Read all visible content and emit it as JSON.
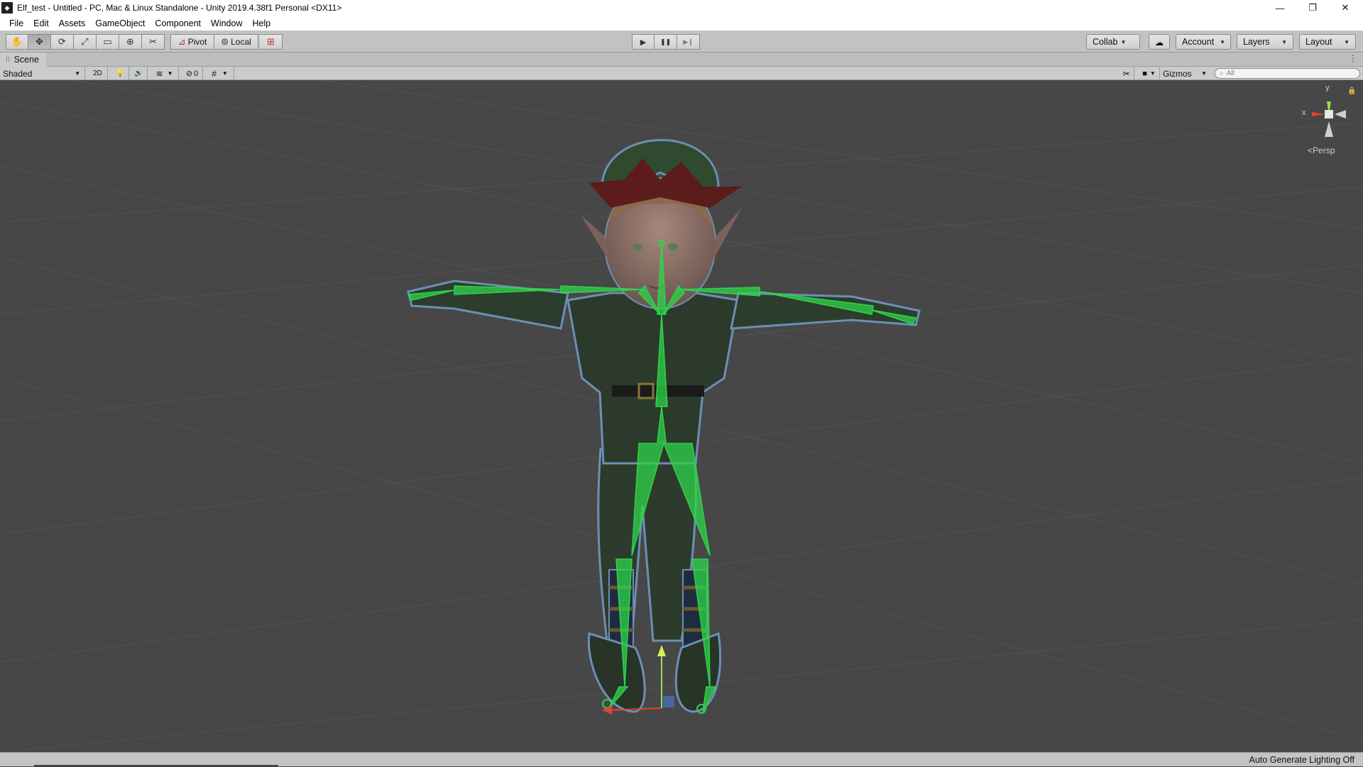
{
  "window": {
    "title": "Elf_test - Untitled - PC, Mac & Linux Standalone - Unity 2019.4.38f1 Personal <DX11>",
    "minimize": "—",
    "maximize": "❐",
    "close": "✕"
  },
  "menu": [
    "File",
    "Edit",
    "Assets",
    "GameObject",
    "Component",
    "Window",
    "Help"
  ],
  "toolbar": {
    "tools": [
      {
        "name": "hand-tool",
        "icon": "hand-icon",
        "glyph": "✋"
      },
      {
        "name": "move-tool",
        "icon": "move-icon",
        "glyph": "✥"
      },
      {
        "name": "rotate-tool",
        "icon": "rotate-icon",
        "glyph": "⟳"
      },
      {
        "name": "scale-tool",
        "icon": "scale-icon",
        "glyph": "⤢"
      },
      {
        "name": "rect-tool",
        "icon": "rect-icon",
        "glyph": "▭"
      },
      {
        "name": "transform-tool",
        "icon": "transform-icon",
        "glyph": "⊕"
      },
      {
        "name": "custom-tool",
        "icon": "custom-tools-icon",
        "glyph": "✂"
      }
    ],
    "pivot_label": "Pivot",
    "local_label": "Local",
    "play_icon": "▶",
    "pause_icon": "❚❚",
    "step_icon": "▶❙",
    "collab_label": "Collab",
    "cloud_icon": "☁",
    "account_label": "Account",
    "layers_label": "Layers",
    "layout_label": "Layout"
  },
  "scene_tab": {
    "label": "Scene",
    "menu_icon": "⋮"
  },
  "scene_controls": {
    "shading_mode": "Shaded",
    "mode_2d": "2D",
    "light_icon": "💡",
    "audio_icon": "🔊",
    "effects_icon": "≋",
    "hidden_count": "0",
    "gizmos_label": "Gizmos",
    "search_placeholder": "All"
  },
  "viewport": {
    "gizmo_axis_y": "y",
    "gizmo_axis_x": "x",
    "projection_label": "Persp",
    "lock_icon": "🔒"
  },
  "status": {
    "text": "Auto Generate Lighting Off"
  },
  "colors": {
    "background": "#474747",
    "bone_green": "#2fd44a",
    "selection_outline": "#6d8fb5",
    "axis_x": "#e2452f",
    "axis_y": "#9be04a",
    "axis_z": "#4a7be0"
  }
}
